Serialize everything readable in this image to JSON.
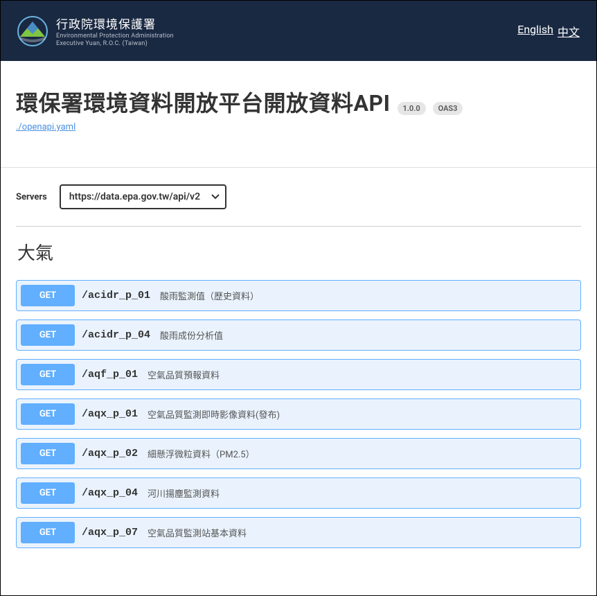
{
  "header": {
    "org_title": "行政院環境保護署",
    "org_subtitle1": "Environmental Protection Administration",
    "org_subtitle2": "Executive Yuan, R.O.C. (Taiwan)",
    "lang_en": "English",
    "lang_zh": "中文"
  },
  "api": {
    "title": "環保署環境資料開放平台開放資料API",
    "version": "1.0.0",
    "oas": "OAS3",
    "spec_link": "./openapi.yaml"
  },
  "servers": {
    "label": "Servers",
    "selected": "https://data.epa.gov.tw/api/v2"
  },
  "category": {
    "title": "大氣"
  },
  "endpoints": [
    {
      "method": "GET",
      "path": "/acidr_p_01",
      "desc": "酸雨監測值（歷史資料）"
    },
    {
      "method": "GET",
      "path": "/acidr_p_04",
      "desc": "酸雨成份分析值"
    },
    {
      "method": "GET",
      "path": "/aqf_p_01",
      "desc": "空氣品質預報資料"
    },
    {
      "method": "GET",
      "path": "/aqx_p_01",
      "desc": "空氣品質監測即時影像資料(發布)"
    },
    {
      "method": "GET",
      "path": "/aqx_p_02",
      "desc": "細懸浮微粒資料（PM2.5）"
    },
    {
      "method": "GET",
      "path": "/aqx_p_04",
      "desc": "河川揚塵監測資料"
    },
    {
      "method": "GET",
      "path": "/aqx_p_07",
      "desc": "空氣品質監測站基本資料"
    }
  ]
}
